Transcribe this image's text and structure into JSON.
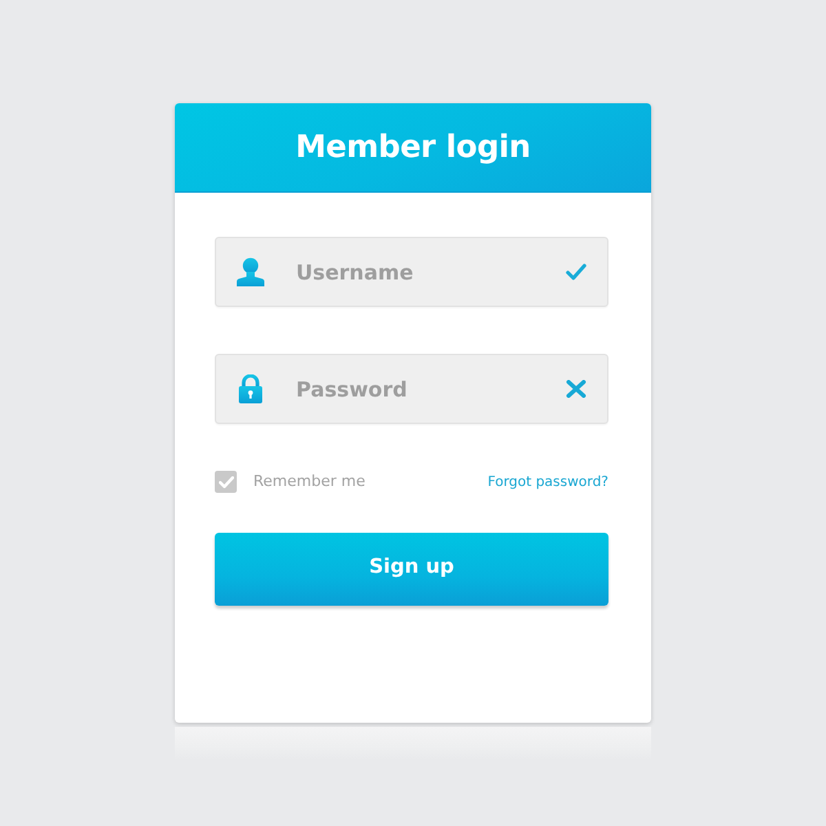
{
  "header": {
    "title": "Member login"
  },
  "fields": [
    {
      "kind": "user",
      "placeholder": "Username",
      "valid": true
    },
    {
      "kind": "lock",
      "placeholder": "Password",
      "valid": false
    }
  ],
  "remember": {
    "label": "Remember me",
    "checked": true
  },
  "forgot_link": "Forgot password?",
  "submit": {
    "label": "Sign up"
  }
}
